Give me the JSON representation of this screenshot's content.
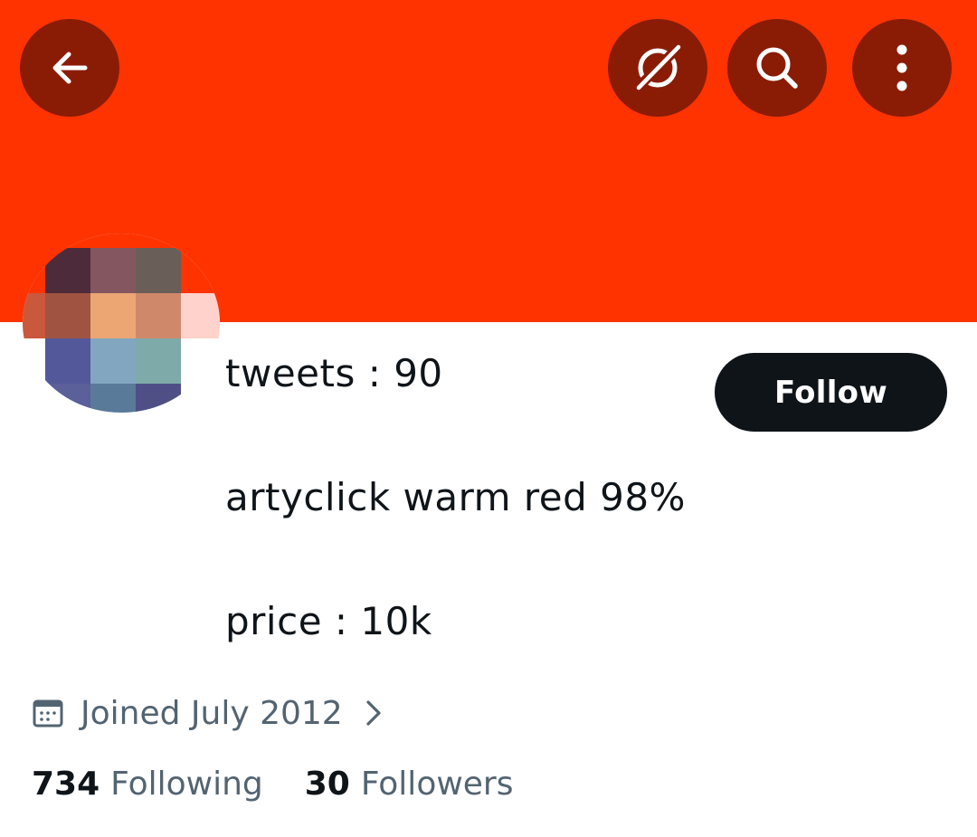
{
  "colors": {
    "banner": "#ff3300",
    "header_button_bg": "#8a1c06",
    "follow_button_bg": "#0f1419",
    "secondary_text": "#536471"
  },
  "header": {
    "icons": [
      "back-arrow-icon",
      "grok-icon",
      "search-icon",
      "more-vertical-icon"
    ]
  },
  "profile": {
    "avatar_blurred": true,
    "bio": {
      "line1": "tweets : 90",
      "line2": "artyclick warm red 98%",
      "line3": "price : 10k"
    },
    "follow_label": "Follow",
    "joined_text": "Joined July 2012",
    "following_count": "734",
    "following_label": "Following",
    "followers_count": "30",
    "followers_label": "Followers"
  }
}
